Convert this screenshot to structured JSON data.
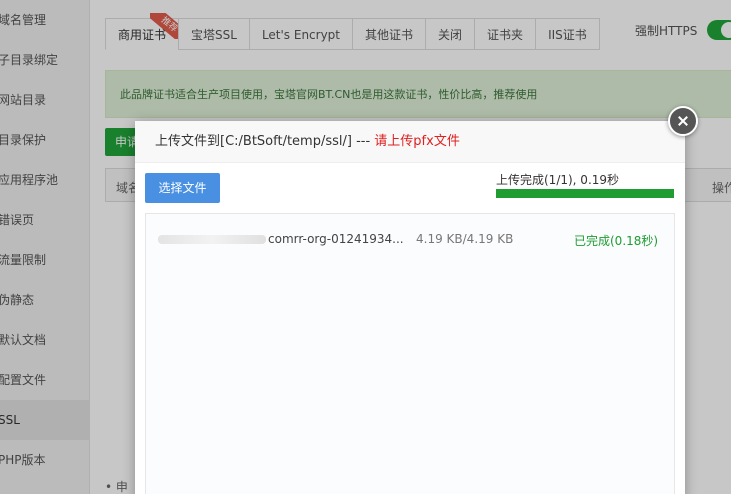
{
  "sidebar": {
    "items": [
      {
        "label": "域名管理"
      },
      {
        "label": "子目录绑定"
      },
      {
        "label": "网站目录"
      },
      {
        "label": "目录保护"
      },
      {
        "label": "应用程序池"
      },
      {
        "label": "错误页"
      },
      {
        "label": "流量限制"
      },
      {
        "label": "伪静态"
      },
      {
        "label": "默认文档"
      },
      {
        "label": "配置文件"
      },
      {
        "label": "SSL"
      },
      {
        "label": "PHP版本"
      }
    ]
  },
  "tabs": {
    "items": [
      {
        "label": "商用证书"
      },
      {
        "label": "宝塔SSL"
      },
      {
        "label": "Let's Encrypt"
      },
      {
        "label": "其他证书"
      },
      {
        "label": "关闭"
      },
      {
        "label": "证书夹"
      },
      {
        "label": "IIS证书"
      }
    ],
    "ribbon": "推荐"
  },
  "https": {
    "label": "强制HTTPS",
    "enabled": true
  },
  "notice": {
    "text": "此品牌证书适合生产项目使用，宝塔官网BT.CN也是用这款证书，性价比高，推荐使用"
  },
  "apply_button": {
    "label": "申请"
  },
  "table": {
    "col_domain": "域名",
    "col_action": "操作"
  },
  "footer_note": "• 申",
  "dialog": {
    "title_prefix": "上传文件到[C:/BtSoft/temp/ssl/] --- ",
    "title_warning": "请上传pfx文件",
    "choose_button": "选择文件",
    "progress_text": "上传完成(1/1), 0.19秒",
    "progress_percent": 100,
    "files": [
      {
        "name": "comrr-org-01241934...",
        "size": "4.19 KB/4.19 KB",
        "status": "已完成(0.18秒)"
      }
    ]
  },
  "colors": {
    "accent_green": "#20a53a",
    "button_blue": "#4a90e2",
    "warning_red": "#e02020"
  }
}
